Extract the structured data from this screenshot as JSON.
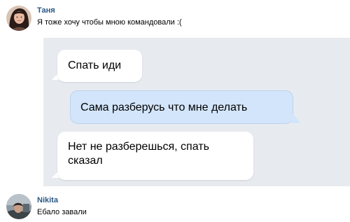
{
  "comments": [
    {
      "author": "Таня",
      "text": "Я тоже хочу чтобы мною командовали :(",
      "avatar_icon": "user-avatar-photo"
    },
    {
      "author": "Nikita",
      "text": "Ебало завали",
      "avatar_icon": "user-avatar-photo"
    }
  ],
  "chat": {
    "messages": [
      {
        "direction": "incoming",
        "lines": [
          "Спать иди"
        ]
      },
      {
        "direction": "outgoing",
        "lines": [
          "Сама разберусь что мне делать"
        ]
      },
      {
        "direction": "incoming",
        "lines": [
          "Нет не разберешься, спать",
          "сказал"
        ]
      }
    ]
  },
  "colors": {
    "author_link": "#2a5885",
    "chat_background": "#e7ebf0",
    "incoming_bubble": "#ffffff",
    "outgoing_bubble": "#d3e5fa"
  }
}
